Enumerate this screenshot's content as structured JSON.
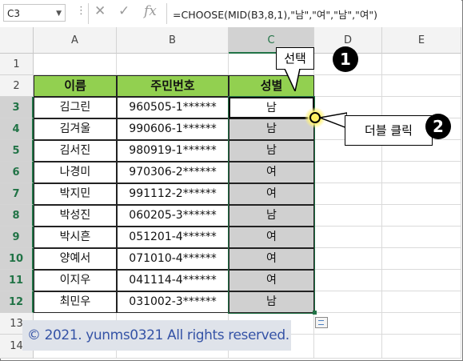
{
  "formula_bar": {
    "cell_ref": "C3",
    "dots": "⋮",
    "cancel_glyph": "✕",
    "enter_glyph": "✓",
    "fx_label": "fx",
    "formula": "=CHOOSE(MID(B3,8,1),\"남\",\"여\",\"남\",\"여\")"
  },
  "columns": [
    "A",
    "B",
    "C",
    "D",
    "E"
  ],
  "rows": [
    "1",
    "2",
    "3",
    "4",
    "5",
    "6",
    "7",
    "8",
    "9",
    "10",
    "11",
    "12",
    "13",
    "14"
  ],
  "table": {
    "headers": [
      "이름",
      "주민번호",
      "성별"
    ],
    "records": [
      {
        "name": "김그린",
        "id": "960505-1******",
        "gender": "남"
      },
      {
        "name": "김겨울",
        "id": "990606-1******",
        "gender": "남"
      },
      {
        "name": "김서진",
        "id": "980919-1******",
        "gender": "남"
      },
      {
        "name": "나경미",
        "id": "970306-2******",
        "gender": "여"
      },
      {
        "name": "박지민",
        "id": "991112-2******",
        "gender": "여"
      },
      {
        "name": "박성진",
        "id": "060205-3******",
        "gender": "남"
      },
      {
        "name": "박시흔",
        "id": "051201-4******",
        "gender": "여"
      },
      {
        "name": "양예서",
        "id": "071010-4******",
        "gender": "여"
      },
      {
        "name": "이지우",
        "id": "041114-4******",
        "gender": "여"
      },
      {
        "name": "최민우",
        "id": "031002-3******",
        "gender": "남"
      }
    ]
  },
  "annotations": {
    "select_label": "선택",
    "select_badge": "1",
    "dblclick_label": "더블 클릭",
    "dblclick_badge": "2"
  },
  "watermark": "© 2021. yunms0321 All rights reserved.",
  "colors": {
    "header_fill": "#92d050",
    "selection": "#217346",
    "gender_fill": "#d0d0d0",
    "watermark_text": "#3553a6"
  }
}
